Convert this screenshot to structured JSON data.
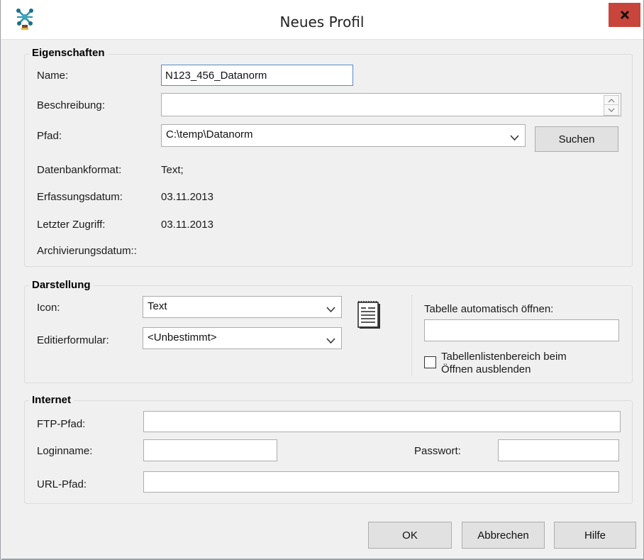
{
  "window": {
    "title": "Neues Profil",
    "app_icon": "star-network-icon",
    "close_icon": "close-icon",
    "close_label": "X"
  },
  "eigenschaften": {
    "group_title": "Eigenschaften",
    "name_label": "Name:",
    "name_value": "N123_456_Datanorm",
    "beschreibung_label": "Beschreibung:",
    "beschreibung_value": "",
    "pfad_label": "Pfad:",
    "pfad_value": "C:\\temp\\Datanorm",
    "suchen_label": "Suchen",
    "datenbankformat_label": "Datenbankformat:",
    "datenbankformat_value": "Text;",
    "erfassungsdatum_label": "Erfassungsdatum:",
    "erfassungsdatum_value": "03.11.2013",
    "letzter_zugriff_label": "Letzter Zugriff:",
    "letzter_zugriff_value": "03.11.2013",
    "archivierungsdatum_label": "Archivierungsdatum::"
  },
  "darstellung": {
    "group_title": "Darstellung",
    "icon_label": "Icon:",
    "icon_value": "Text",
    "editierformular_label": "Editierformular:",
    "editierformular_value": "<Unbestimmt>",
    "preview_icon": "text-document-icon",
    "tabelle_label": "Tabelle automatisch öffnen:",
    "tabelle_value": "",
    "checkbox_label_line1": "Tabellenlistenbereich beim",
    "checkbox_label_line2": "Öffnen ausblenden",
    "checkbox_checked": false
  },
  "internet": {
    "group_title": "Internet",
    "ftp_label": "FTP-Pfad:",
    "ftp_value": "",
    "login_label": "Loginname:",
    "login_value": "",
    "passwort_label": "Passwort:",
    "passwort_value": "",
    "url_label": "URL-Pfad:",
    "url_value": ""
  },
  "buttons": {
    "ok": "OK",
    "abbrechen": "Abbrechen",
    "hilfe": "Hilfe"
  },
  "colors": {
    "close_button": "#c8453c",
    "focus_border": "#5a8ac4",
    "dialog_bg": "#f0f0f0"
  }
}
